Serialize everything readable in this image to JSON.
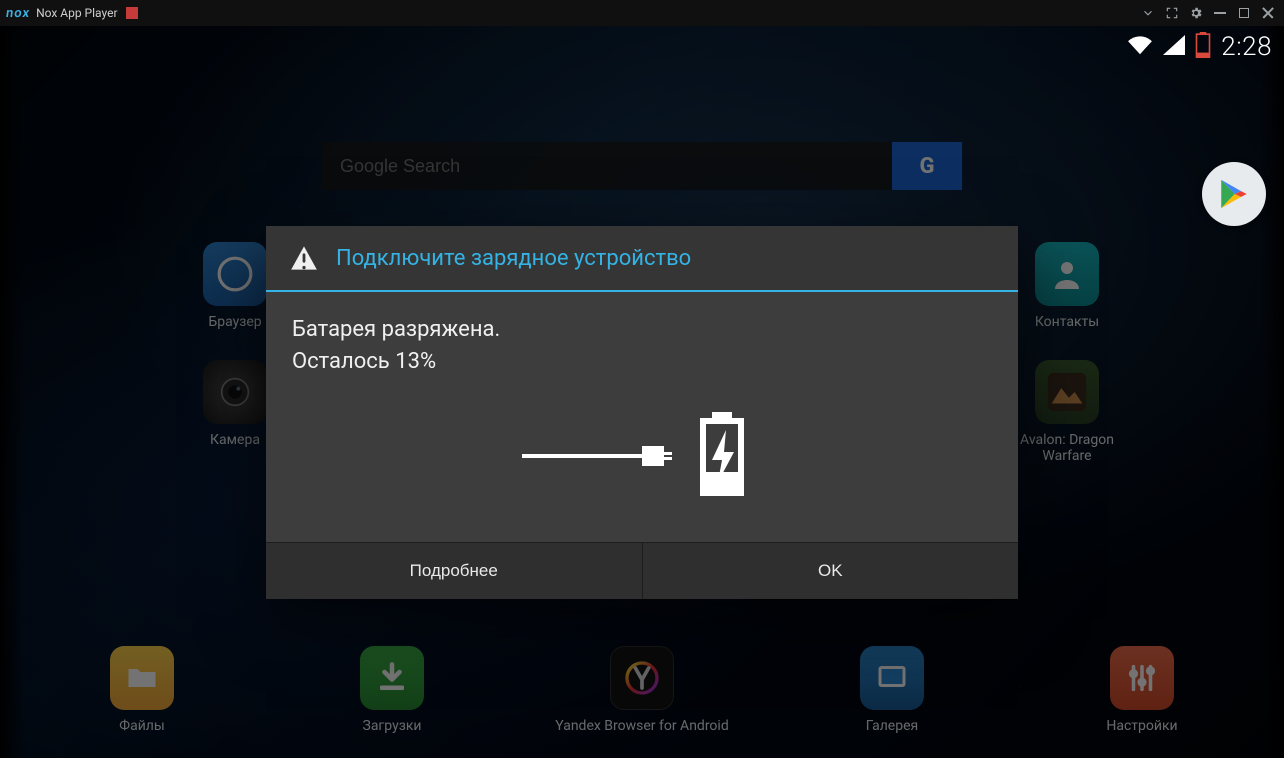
{
  "window": {
    "title": "Nox App Player",
    "logo": "nox"
  },
  "status": {
    "time": "2:28"
  },
  "search": {
    "placeholder": "Google Search"
  },
  "apps": {
    "browser": "Браузер",
    "contacts": "Контакты",
    "camera": "Камера",
    "game": "Avalon: Dragon Warfare"
  },
  "dock": {
    "files": "Файлы",
    "downloads": "Загрузки",
    "ybrowser": "Yandex Browser for Android",
    "gallery": "Галерея",
    "settings": "Настройки"
  },
  "dialog": {
    "title": "Подключите зарядное устройство",
    "line1": "Батарея разряжена.",
    "line2": "Осталось 13%",
    "more": "Подробнее",
    "ok": "OK"
  }
}
